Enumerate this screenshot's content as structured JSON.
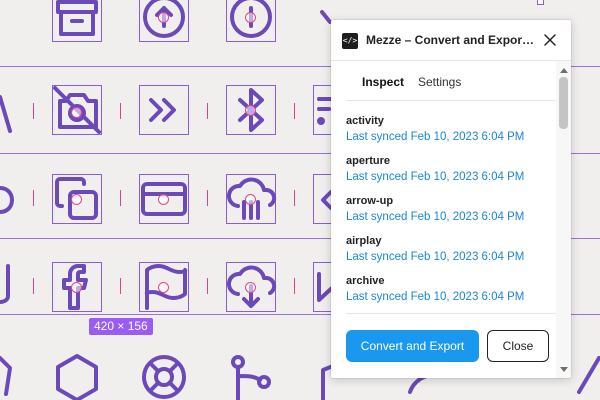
{
  "canvas": {
    "selection_size_label": "420 × 156",
    "icons": [
      "archive-icon",
      "arrow-up-circle-icon",
      "arrow-up-icon",
      "chevrons-right-icon",
      "bluetooth-icon",
      "camera-off-icon",
      "rss-icon",
      "copy-icon",
      "credit-card-icon",
      "cloud-drizzle-icon",
      "facebook-icon",
      "flag-icon",
      "download-cloud-icon",
      "play-icon",
      "hexagon-icon",
      "life-buoy-icon",
      "git-branch-icon"
    ]
  },
  "plugin": {
    "title": "Mezze – Convert and Export I...",
    "app_icon_glyph": "</>",
    "tabs": [
      {
        "label": "Inspect",
        "active": true
      },
      {
        "label": "Settings",
        "active": false
      }
    ],
    "items": [
      {
        "name": "activity",
        "sync": "Last synced Feb 10, 2023 6:04 PM"
      },
      {
        "name": "aperture",
        "sync": "Last synced Feb 10, 2023 6:04 PM"
      },
      {
        "name": "arrow-up",
        "sync": "Last synced Feb 10, 2023 6:04 PM"
      },
      {
        "name": "airplay",
        "sync": "Last synced Feb 10, 2023 6:04 PM"
      },
      {
        "name": "archive",
        "sync": "Last synced Feb 10, 2023 6:04 PM"
      }
    ],
    "primary_button": "Convert and Export",
    "secondary_button": "Close"
  },
  "colors": {
    "icon_stroke": "#6b49b8",
    "frame_outline": "#8b5cd6",
    "marker_pink": "#e0468e",
    "link_blue": "#1a86d6",
    "primary_button": "#1a98f0"
  }
}
